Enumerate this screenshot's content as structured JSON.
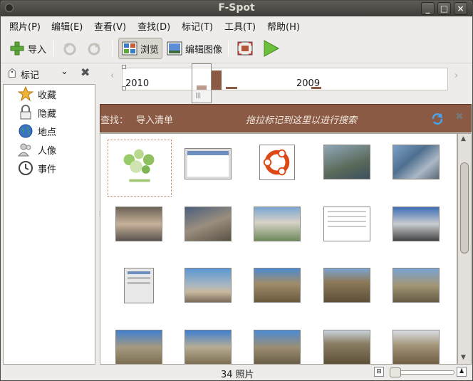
{
  "window": {
    "title": "F-Spot"
  },
  "menubar": {
    "items": [
      {
        "label": "照片(P)"
      },
      {
        "label": "编辑(E)"
      },
      {
        "label": "查看(V)"
      },
      {
        "label": "查找(D)"
      },
      {
        "label": "标记(T)"
      },
      {
        "label": "工具(T)"
      },
      {
        "label": "帮助(H)"
      }
    ]
  },
  "toolbar": {
    "import_label": "导入",
    "browse_label": "浏览",
    "edit_label": "编辑图像"
  },
  "sidebar": {
    "header_label": "标记",
    "items": [
      {
        "label": "收藏",
        "icon": "star-icon"
      },
      {
        "label": "隐藏",
        "icon": "lock-icon"
      },
      {
        "label": "地点",
        "icon": "globe-icon"
      },
      {
        "label": "人像",
        "icon": "people-icon"
      },
      {
        "label": "事件",
        "icon": "clock-icon"
      }
    ]
  },
  "timeline": {
    "years": [
      "2010",
      "2009"
    ]
  },
  "findbar": {
    "find_label": "查找：",
    "import_list": "导入清单",
    "hint": "拖拉标记到这里以进行搜索"
  },
  "photos": {
    "count_text": "34 照片"
  },
  "colors": {
    "findbar_bg": "#8b5a44",
    "titlebar_bg": "#3e3d39"
  }
}
